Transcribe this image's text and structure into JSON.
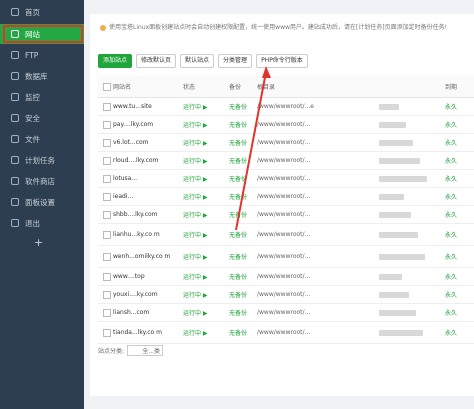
{
  "sidebar": {
    "items": [
      {
        "label": "首页",
        "icon": "home-icon"
      },
      {
        "label": "网站",
        "icon": "globe-icon",
        "active": true
      },
      {
        "label": "FTP",
        "icon": "ftp-icon"
      },
      {
        "label": "数据库",
        "icon": "database-icon"
      },
      {
        "label": "监控",
        "icon": "monitor-icon"
      },
      {
        "label": "安全",
        "icon": "shield-icon"
      },
      {
        "label": "文件",
        "icon": "folder-icon"
      },
      {
        "label": "计划任务",
        "icon": "clock-icon"
      },
      {
        "label": "软件商店",
        "icon": "store-icon"
      },
      {
        "label": "面板设置",
        "icon": "gear-icon"
      },
      {
        "label": "退出",
        "icon": "logout-icon"
      }
    ],
    "add_symbol": "+"
  },
  "notice": {
    "text": "使用宝塔Linux面板创建站点时会自动创建权限配置，统一使用www用户。建站成功后，请在[计划任务]页面添加定时备份任务!"
  },
  "toolbar": {
    "add": "添加站点",
    "default_page": "修改默认页",
    "default_site": "默认站点",
    "category": "分类管理",
    "php_cli": "PHP命令行版本"
  },
  "table": {
    "headers": [
      "网站名",
      "状态",
      "备份",
      "根目录",
      "",
      "到期"
    ],
    "rows": [
      {
        "name": "www.tu...site",
        "status": "运行中 ▶",
        "backup": "无备份",
        "root": "/www/wwwroot/...e",
        "expire": "永久"
      },
      {
        "name": "pay....lky.com",
        "status": "运行中 ▶",
        "backup": "无备份",
        "root": "/www/wwwroot/...",
        "expire": "永久"
      },
      {
        "name": "v6.lot...com",
        "status": "运行中 ▶",
        "backup": "无备份",
        "root": "/www/wwwroot/...",
        "expire": "永久"
      },
      {
        "name": "rloud....lky.com",
        "status": "运行中 ▶",
        "backup": "无备份",
        "root": "/www/wwwroot/...",
        "expire": "永久"
      },
      {
        "name": "lotusa...",
        "status": "运行中 ▶",
        "backup": "无备份",
        "root": "/www/wwwroot/...",
        "expire": "永久"
      },
      {
        "name": "ieadi...",
        "status": "运行中 ▶",
        "backup": "无备份",
        "root": "/www/wwwroot/...",
        "expire": "永久"
      },
      {
        "name": "shbb....lky.com",
        "status": "运行中 ▶",
        "backup": "无备份",
        "root": "/www/wwwroot/...",
        "expire": "永久"
      },
      {
        "name": "lianhu...ky.co m",
        "status": "运行中 ▶",
        "backup": "无备份",
        "root": "/www/wwwroot/...",
        "expire": "永久"
      },
      {
        "name": "wenh...omilky.co m",
        "status": "运行中 ▶",
        "backup": "无备份",
        "root": "/www/wwwroot/...",
        "expire": "永久"
      },
      {
        "name": "www....top",
        "status": "运行中 ▶",
        "backup": "无备份",
        "root": "/www/wwwroot/...",
        "expire": "永久"
      },
      {
        "name": "youxi....ky.com",
        "status": "运行中 ▶",
        "backup": "无备份",
        "root": "/www/wwwroot/...",
        "expire": "永久"
      },
      {
        "name": "liansh...com",
        "status": "运行中 ▶",
        "backup": "无备份",
        "root": "/www/wwwroot/...",
        "expire": "永久"
      },
      {
        "name": "tianda...lky.co m",
        "status": "运行中 ▶",
        "backup": "无备份",
        "root": "/www/wwwroot/...",
        "expire": "永久"
      }
    ]
  },
  "footer": {
    "label": "站点分类:",
    "select": "全...类"
  },
  "colors": {
    "sidebar": "#2c3e50",
    "accent": "#20a53a",
    "highlight": "#e3322c"
  }
}
